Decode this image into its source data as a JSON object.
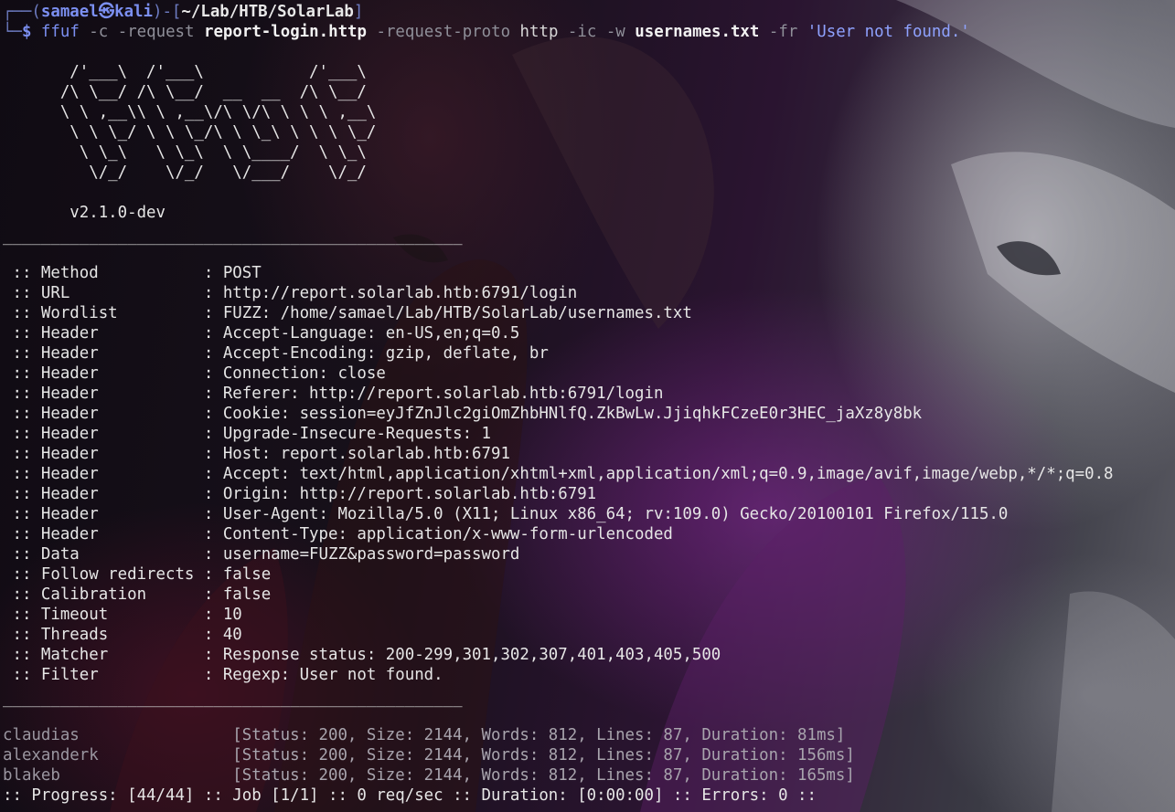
{
  "prompt": {
    "box_top": "┌──(",
    "user": "samael㉿kali",
    "box_mid": ")-[",
    "cwd": "~/Lab/HTB/SolarLab",
    "box_end": "]",
    "box_bottom": "└─",
    "dollar": "$",
    "command": {
      "program": "ffuf",
      "flag_c": "-c",
      "flag_request": "-request",
      "request_file": "report-login.http",
      "flag_proto": "-request-proto",
      "proto": "http",
      "flag_ic": "-ic",
      "flag_w": "-w",
      "wordlist": "usernames.txt",
      "flag_fr": "-fr",
      "filter": "'User not found.'"
    }
  },
  "banner": [
    "       /'___\\  /'___\\           /'___\\",
    "      /\\ \\__/ /\\ \\__/  __  __  /\\ \\__/",
    "      \\ \\ ,__\\\\ \\ ,__\\/\\ \\/\\ \\ \\ \\ ,__\\",
    "       \\ \\ \\_/ \\ \\ \\_/\\ \\ \\_\\ \\ \\ \\ \\_/",
    "        \\ \\_\\   \\ \\_\\  \\ \\____/  \\ \\_\\",
    "         \\/_/    \\/_/   \\/___/    \\/_/"
  ],
  "version": "       v2.1.0-dev",
  "separator": "________________________________________________",
  "config": [
    {
      "key": " :: Method           ",
      "value": ": POST"
    },
    {
      "key": " :: URL              ",
      "value": ": http://report.solarlab.htb:6791/login"
    },
    {
      "key": " :: Wordlist         ",
      "value": ": FUZZ: /home/samael/Lab/HTB/SolarLab/usernames.txt"
    },
    {
      "key": " :: Header           ",
      "value": ": Accept-Language: en-US,en;q=0.5"
    },
    {
      "key": " :: Header           ",
      "value": ": Accept-Encoding: gzip, deflate, br"
    },
    {
      "key": " :: Header           ",
      "value": ": Connection: close"
    },
    {
      "key": " :: Header           ",
      "value": ": Referer: http://report.solarlab.htb:6791/login"
    },
    {
      "key": " :: Header           ",
      "value": ": Cookie: session=eyJfZnJlc2giOmZhbHNlfQ.ZkBwLw.JjiqhkFCzeE0r3HEC_jaXz8y8bk"
    },
    {
      "key": " :: Header           ",
      "value": ": Upgrade-Insecure-Requests: 1"
    },
    {
      "key": " :: Header           ",
      "value": ": Host: report.solarlab.htb:6791"
    },
    {
      "key": " :: Header           ",
      "value": ": Accept: text/html,application/xhtml+xml,application/xml;q=0.9,image/avif,image/webp,*/*;q=0.8"
    },
    {
      "key": " :: Header           ",
      "value": ": Origin: http://report.solarlab.htb:6791"
    },
    {
      "key": " :: Header           ",
      "value": ": User-Agent: Mozilla/5.0 (X11; Linux x86_64; rv:109.0) Gecko/20100101 Firefox/115.0"
    },
    {
      "key": " :: Header           ",
      "value": ": Content-Type: application/x-www-form-urlencoded"
    },
    {
      "key": " :: Data             ",
      "value": ": username=FUZZ&password=password"
    },
    {
      "key": " :: Follow redirects ",
      "value": ": false"
    },
    {
      "key": " :: Calibration      ",
      "value": ": false"
    },
    {
      "key": " :: Timeout          ",
      "value": ": 10"
    },
    {
      "key": " :: Threads          ",
      "value": ": 40"
    },
    {
      "key": " :: Matcher          ",
      "value": ": Response status: 200-299,301,302,307,401,403,405,500"
    },
    {
      "key": " :: Filter           ",
      "value": ": Regexp: User not found."
    }
  ],
  "results": [
    {
      "name": "claudias                ",
      "info": "[Status: 200, Size: 2144, Words: 812, Lines: 87, Duration: 81ms]"
    },
    {
      "name": "alexanderk              ",
      "info": "[Status: 200, Size: 2144, Words: 812, Lines: 87, Duration: 156ms]"
    },
    {
      "name": "blakeb                  ",
      "info": "[Status: 200, Size: 2144, Words: 812, Lines: 87, Duration: 165ms]"
    }
  ],
  "progress": ":: Progress: [44/44] :: Job [1/1] :: 0 req/sec :: Duration: [0:00:00] :: Errors: 0 ::",
  "colors": {
    "background": "#0e0a11",
    "prompt_accent": "#7b8ff0",
    "text": "#e4e4e4",
    "flag_text": "#8f8f99",
    "result_text": "#a8a4ad"
  }
}
